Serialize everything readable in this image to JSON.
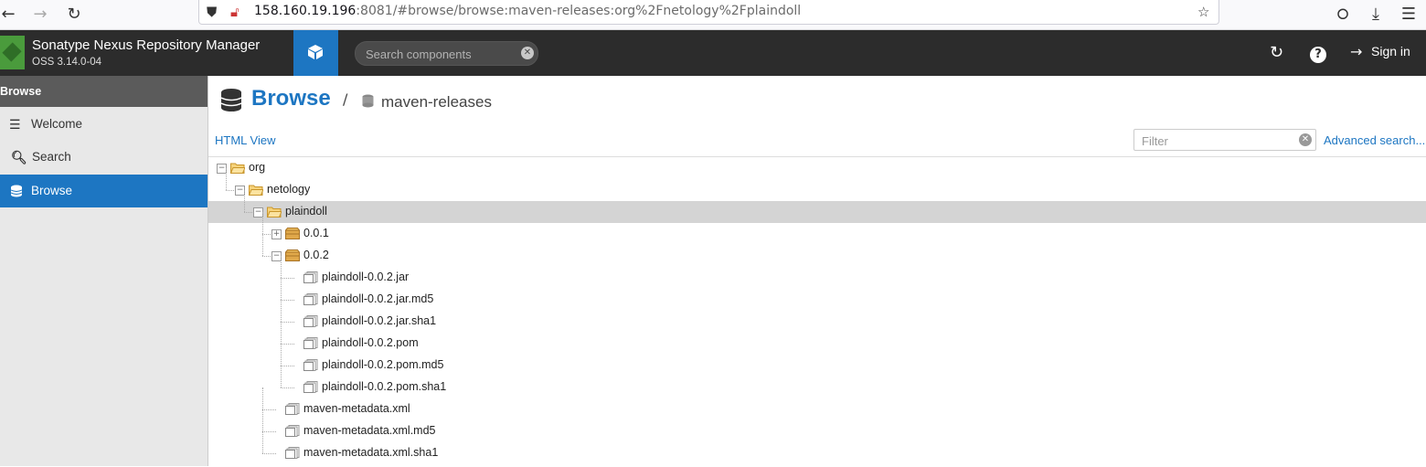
{
  "browser": {
    "url_host": "158.160.19.196",
    "url_rest": ":8081/#browse/browse:maven-releases:org%2Fnetology%2Fplaindoll"
  },
  "header": {
    "app_name": "Sonatype Nexus Repository Manager",
    "version": "OSS 3.14.0-04",
    "search_placeholder": "Search components",
    "signin_label": "Sign in"
  },
  "sidebar": {
    "heading": "Browse",
    "items": [
      {
        "label": "Welcome",
        "icon": "list-icon"
      },
      {
        "label": "Search",
        "icon": "search-icon"
      },
      {
        "label": "Browse",
        "icon": "database-icon",
        "selected": true
      }
    ]
  },
  "main": {
    "title": "Browse",
    "separator": "/",
    "breadcrumb": "maven-releases",
    "html_view": "HTML View",
    "filter_placeholder": "Filter",
    "advanced_search": "Advanced search..."
  },
  "tree": [
    {
      "label": "org",
      "type": "folder-open",
      "toggle": "minus"
    },
    {
      "label": "netology",
      "type": "folder-open",
      "toggle": "minus"
    },
    {
      "label": "plaindoll",
      "type": "folder-open",
      "toggle": "minus",
      "selected": true
    },
    {
      "label": "0.0.1",
      "type": "component",
      "toggle": "plus"
    },
    {
      "label": "0.0.2",
      "type": "component",
      "toggle": "minus"
    },
    {
      "label": "plaindoll-0.0.2.jar",
      "type": "file"
    },
    {
      "label": "plaindoll-0.0.2.jar.md5",
      "type": "file"
    },
    {
      "label": "plaindoll-0.0.2.jar.sha1",
      "type": "file"
    },
    {
      "label": "plaindoll-0.0.2.pom",
      "type": "file"
    },
    {
      "label": "plaindoll-0.0.2.pom.md5",
      "type": "file"
    },
    {
      "label": "plaindoll-0.0.2.pom.sha1",
      "type": "file"
    },
    {
      "label": "maven-metadata.xml",
      "type": "file"
    },
    {
      "label": "maven-metadata.xml.md5",
      "type": "file"
    },
    {
      "label": "maven-metadata.xml.sha1",
      "type": "file"
    }
  ],
  "colors": {
    "accent": "#1d76c2",
    "header_bg": "#2c2c2c",
    "folder": "#f0c050",
    "component": "#e0a84a"
  }
}
